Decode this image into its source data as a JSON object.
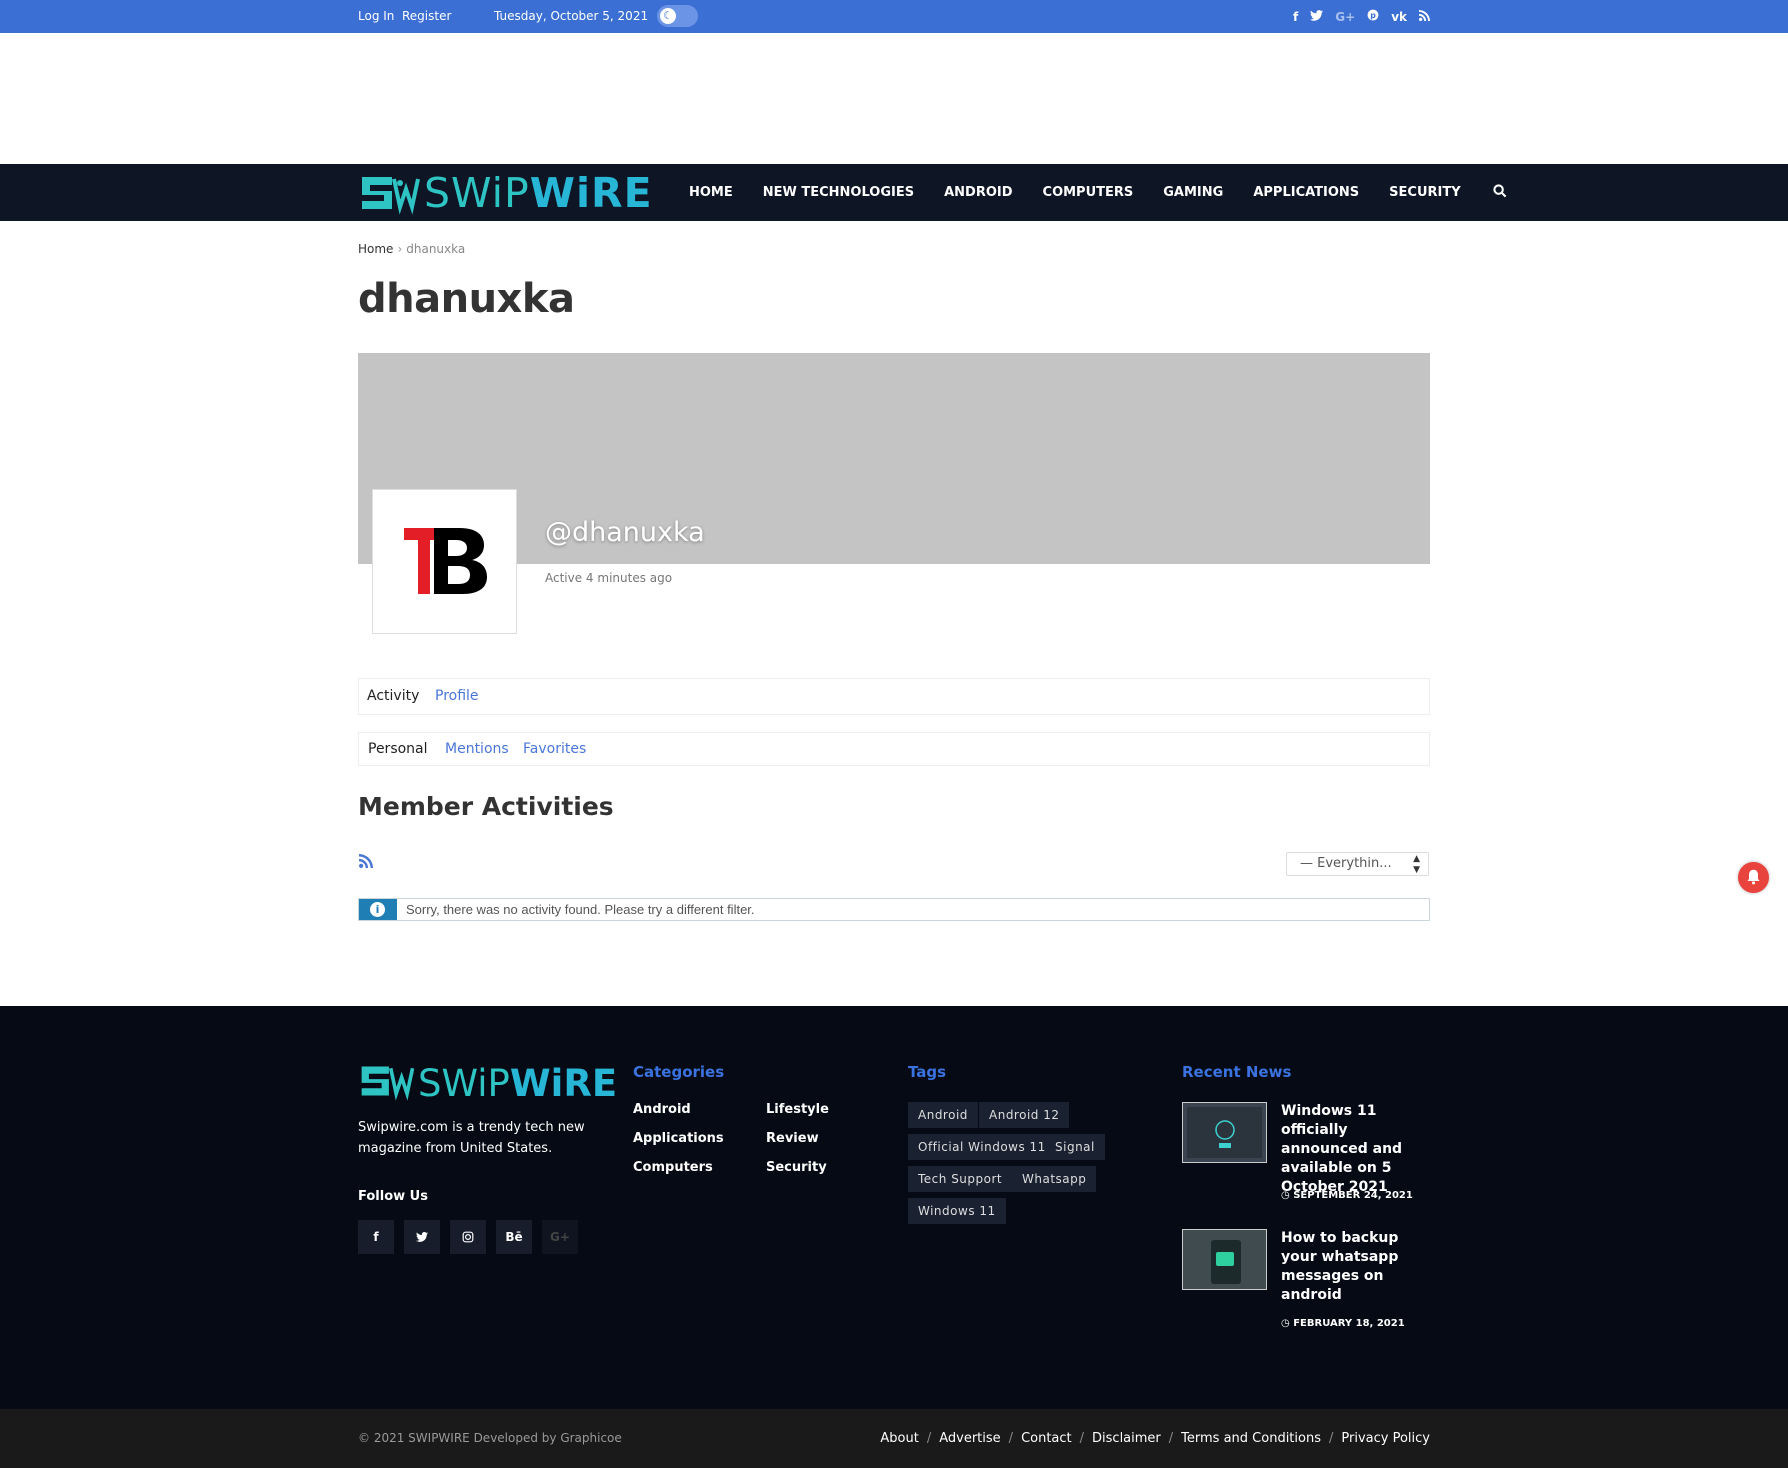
{
  "topbar": {
    "login": "Log In",
    "register": "Register",
    "date": "Tuesday, October 5, 2021",
    "social": [
      "f",
      "t",
      "G+",
      "p",
      "vk",
      "rss"
    ]
  },
  "logo": {
    "part1": "SWiP",
    "part2": "WiRE"
  },
  "nav": [
    "HOME",
    "NEW TECHNOLOGIES",
    "ANDROID",
    "COMPUTERS",
    "GAMING",
    "APPLICATIONS",
    "SECURITY"
  ],
  "breadcrumb": {
    "home": "Home",
    "current": "dhanuxka"
  },
  "page_title": "dhanuxka",
  "profile": {
    "handle": "@dhanuxka",
    "active": "Active 4 minutes ago",
    "avatar_text": "TB"
  },
  "tabs_main": [
    "Activity",
    "Profile"
  ],
  "tabs_sub": [
    "Personal",
    "Mentions",
    "Favorites"
  ],
  "section_title": "Member Activities",
  "filter": {
    "selected": "— Everythin..."
  },
  "notice": "Sorry, there was no activity found. Please try a different filter.",
  "footer": {
    "description": "Swipwire.com is a trendy tech new magazine from United States.",
    "follow_label": "Follow Us",
    "social": [
      "f",
      "t",
      "ig",
      "Bē",
      "G+"
    ],
    "categories_heading": "Categories",
    "categories_col1": [
      "Android",
      "Applications",
      "Computers"
    ],
    "categories_col2": [
      "Lifestyle",
      "Review",
      "Security"
    ],
    "tags_heading": "Tags",
    "tags": [
      "Android",
      "Android 12",
      "Official Windows 11",
      "Signal",
      "Tech Support",
      "Whatsapp",
      "Windows 11"
    ],
    "news_heading": "Recent News",
    "news": [
      {
        "title": "Windows 11 officially announced and available on 5 October 2021",
        "date": "SEPTEMBER 24, 2021"
      },
      {
        "title": "How to backup your whatsapp messages on android",
        "date": "FEBRUARY 18, 2021"
      }
    ],
    "copyright": "© 2021 SWIPWIRE Developed by Graphicoe",
    "links": [
      "About",
      "Advertise",
      "Contact",
      "Disclaimer",
      "Terms and Conditions",
      "Privacy Policy"
    ]
  }
}
